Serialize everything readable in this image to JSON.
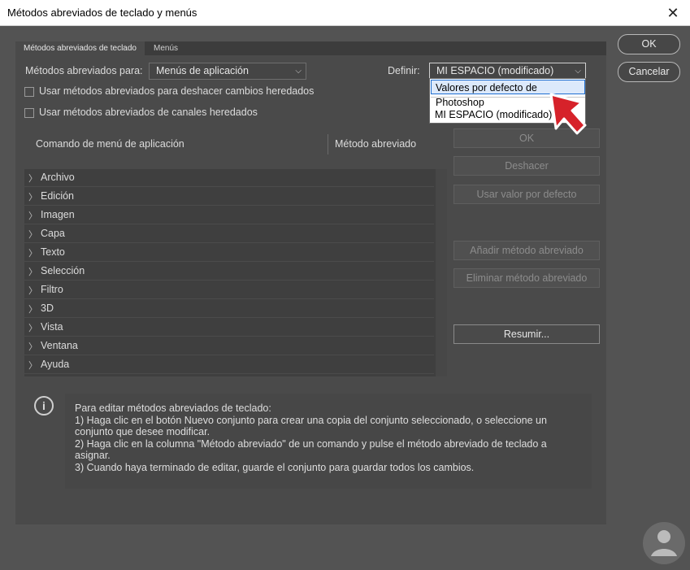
{
  "window": {
    "title": "Métodos abreviados de teclado y menús",
    "close": "✕"
  },
  "tabs": {
    "active": "Métodos abreviados de teclado",
    "inactive": "Menús"
  },
  "form": {
    "shortcuts_for_label": "Métodos abreviados para:",
    "shortcuts_for_value": "Menús de aplicación",
    "define_label": "Definir:",
    "define_value": "MI ESPACIO (modificado)",
    "checkbox1": "Usar métodos abreviados para deshacer cambios heredados",
    "checkbox2": "Usar métodos abreviados de canales heredados"
  },
  "dropdown": {
    "selected": "Valores por defecto de Photoshop",
    "option": "MI ESPACIO (modificado)"
  },
  "columns": {
    "command": "Comando de menú de aplicación",
    "shortcut": "Método abreviado"
  },
  "menu_items": [
    "Archivo",
    "Edición",
    "Imagen",
    "Capa",
    "Texto",
    "Selección",
    "Filtro",
    "3D",
    "Vista",
    "Ventana",
    "Ayuda"
  ],
  "side_buttons": {
    "ok": "OK",
    "undo": "Deshacer",
    "default": "Usar valor por defecto",
    "add": "Añadir método abreviado",
    "remove": "Eliminar método abreviado",
    "summarize": "Resumir..."
  },
  "dialog_buttons": {
    "ok": "OK",
    "cancel": "Cancelar"
  },
  "info": {
    "lines": [
      "Para editar métodos abreviados de teclado:",
      "1) Haga clic en el botón Nuevo conjunto para crear una copia del conjunto seleccionado, o seleccione un",
      "conjunto que desee modificar.",
      "2) Haga clic en la columna \"Método abreviado\" de un comando y pulse el método abreviado de teclado a",
      "asignar.",
      "3) Cuando haya terminado de editar, guarde el conjunto para guardar todos los cambios."
    ]
  },
  "icons": {
    "expand": "chevron-right-icon",
    "info": "info-icon",
    "pointer": "red-arrow-cursor-icon"
  },
  "colors": {
    "accent": "#1f6fd1",
    "pointer": "#d6222a"
  }
}
